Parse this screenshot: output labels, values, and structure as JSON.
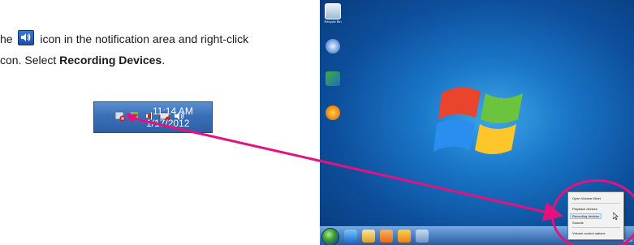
{
  "instructions": {
    "line1_pre": "he",
    "line1_post": "icon in the notification area and right-click",
    "line2_pre": "con. Select",
    "line2_bold": "Recording Devices",
    "line2_post": "."
  },
  "taskbar_crop": {
    "time": "11:14 AM",
    "date": "1/17/2012",
    "icons": [
      "network-x-icon",
      "flag-icon",
      "speaker-icon",
      "device-icon",
      "volume-icon"
    ]
  },
  "desktop": {
    "icons": [
      {
        "name": "recycle-bin-icon",
        "label": "Recycle Bin"
      },
      {
        "name": "desktop-icon-2",
        "label": ""
      },
      {
        "name": "desktop-icon-3",
        "label": ""
      },
      {
        "name": "desktop-icon-4",
        "label": ""
      }
    ],
    "context_menu": {
      "items": [
        "Open Volume Mixer",
        "Playback devices",
        "Recording devices",
        "Sounds",
        "Volume control options"
      ],
      "highlighted": "Recording devices"
    },
    "clock_date": "1/5/20"
  },
  "colors": {
    "arrow": "#e3127f",
    "taskbar": "#3a6fb8",
    "desktop_bg": "#1a77c9"
  }
}
